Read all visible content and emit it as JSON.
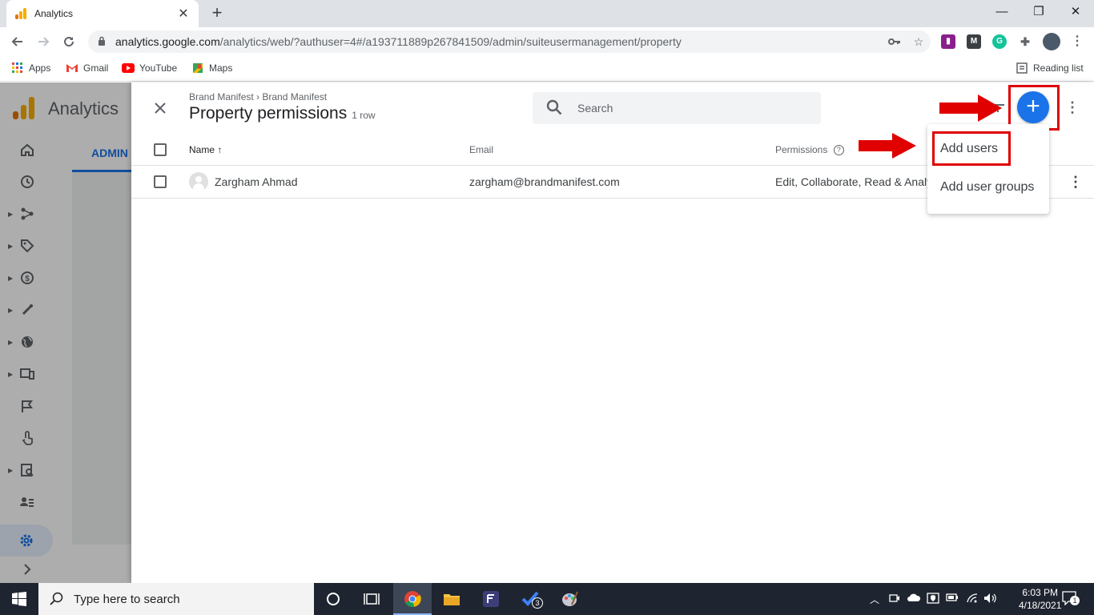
{
  "browser": {
    "tab_title": "Analytics",
    "tab_close": "✕",
    "new_tab": "+",
    "url_host": "analytics.google.com",
    "url_path": "/analytics/web/?authuser=4#/a193711889p267841509/admin/suiteusermanagement/property",
    "window_controls": [
      "—",
      "❐",
      "✕"
    ]
  },
  "bookmarks": {
    "items": [
      {
        "label": "Apps",
        "icon": "apps-grid-icon"
      },
      {
        "label": "Gmail",
        "icon": "gmail-icon"
      },
      {
        "label": "YouTube",
        "icon": "youtube-icon"
      },
      {
        "label": "Maps",
        "icon": "maps-icon"
      }
    ],
    "reading_list": "Reading list"
  },
  "analytics": {
    "app_title": "Analytics",
    "admin_tab": "ADMIN"
  },
  "panel": {
    "breadcrumb": "Brand Manifest › Brand Manifest",
    "title": "Property permissions",
    "row_count": "1 row",
    "search_placeholder": "Search",
    "columns": {
      "name": "Name",
      "email": "Email",
      "permissions": "Permissions"
    },
    "rows": [
      {
        "name": "Zargham Ahmad",
        "email": "zargham@brandmanifest.com",
        "permissions": "Edit, Collaborate, Read & Analy"
      }
    ],
    "menu": {
      "add_users": "Add users",
      "add_user_groups": "Add user groups"
    }
  },
  "taskbar": {
    "search_placeholder": "Type here to search",
    "time": "6:03 PM",
    "date": "4/18/2021",
    "notification_count": "1",
    "todo_badge": "3"
  },
  "colors": {
    "accent": "#1a73e8",
    "annotation_red": "#e00000",
    "taskbar": "#1f2530"
  }
}
